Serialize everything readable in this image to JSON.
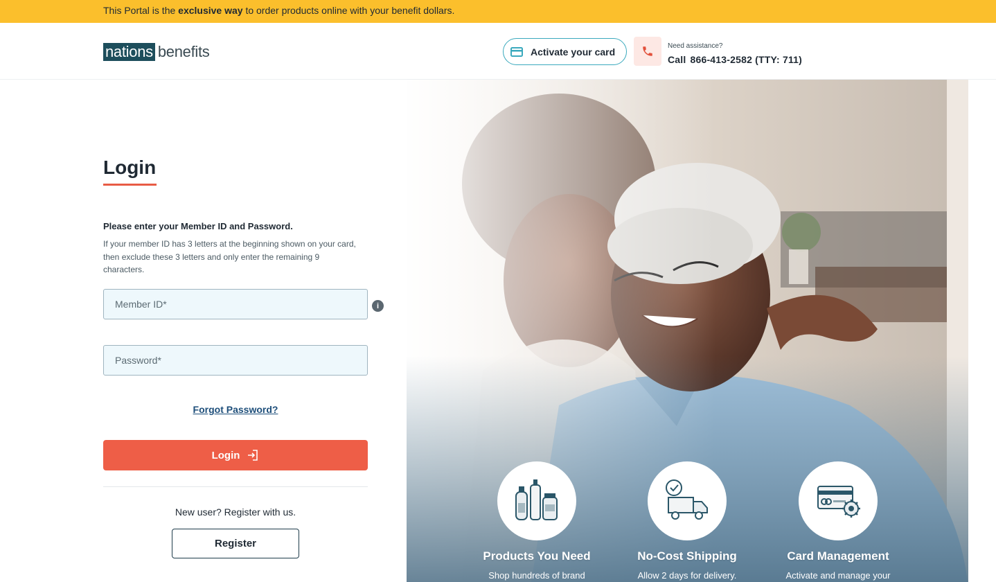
{
  "banner": {
    "text_before": "This Portal is the ",
    "text_bold": "exclusive way",
    "text_after": " to order products online with your benefit dollars."
  },
  "header": {
    "logo_left": "nations",
    "logo_right": "benefits",
    "activate_label": "Activate your card",
    "assist_label": "Need assistance?",
    "call_label": "Call",
    "phone_number": "866-413-2582 (TTY: 711)"
  },
  "login": {
    "title": "Login",
    "instruction_title": "Please enter your Member ID and Password.",
    "instruction_text": "If your member ID has 3 letters at the beginning shown on your card, then exclude these 3 letters and only enter the remaining 9 characters.",
    "member_id_placeholder": "Member ID*",
    "member_id_value": "",
    "password_placeholder": "Password*",
    "password_value": "",
    "info_icon_glyph": "i",
    "forgot_password": "Forgot Password?",
    "login_button": "Login",
    "new_user_text": "New user? Register with us.",
    "register_button": "Register"
  },
  "features": [
    {
      "title": "Products You Need",
      "desc": "Shop hundreds of brand",
      "icon": "products-icon"
    },
    {
      "title": "No-Cost Shipping",
      "desc": "Allow 2 days for delivery.",
      "icon": "delivery-truck-icon"
    },
    {
      "title": "Card Management",
      "desc": "Activate and manage your",
      "icon": "card-settings-icon"
    }
  ],
  "colors": {
    "banner": "#fbbf2c",
    "brand_dark": "#1d4e5c",
    "accent_teal": "#3aa9bd",
    "login_button": "#ee5e47",
    "input_bg": "#eef8fc"
  }
}
